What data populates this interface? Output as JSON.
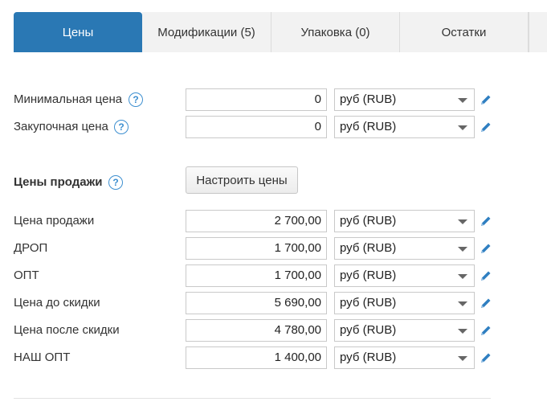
{
  "tabs": [
    {
      "label": "Цены",
      "active": true
    },
    {
      "label": "Модификации (5)",
      "active": false
    },
    {
      "label": "Упаковка (0)",
      "active": false
    },
    {
      "label": "Остатки",
      "active": false
    }
  ],
  "base_prices": {
    "min_price": {
      "label": "Минимальная цена",
      "value": "0",
      "currency": "руб (RUB)"
    },
    "purchase_price": {
      "label": "Закупочная цена",
      "value": "0",
      "currency": "руб (RUB)"
    }
  },
  "sale_prices": {
    "heading": "Цены продажи",
    "configure_button": "Настроить цены",
    "items": [
      {
        "label": "Цена продажи",
        "value": "2 700,00",
        "currency": "руб (RUB)"
      },
      {
        "label": "ДРОП",
        "value": "1 700,00",
        "currency": "руб (RUB)"
      },
      {
        "label": "ОПТ",
        "value": "1 700,00",
        "currency": "руб (RUB)"
      },
      {
        "label": "Цена до скидки",
        "value": "5 690,00",
        "currency": "руб (RUB)"
      },
      {
        "label": "Цена после скидки",
        "value": "4 780,00",
        "currency": "руб (RUB)"
      },
      {
        "label": "НАШ ОПТ",
        "value": "1 400,00",
        "currency": "руб (RUB)"
      }
    ]
  },
  "help_glyph": "?",
  "colors": {
    "accent": "#2a78b4",
    "help": "#3d8fd0",
    "pencil": "#2f7fc1"
  }
}
